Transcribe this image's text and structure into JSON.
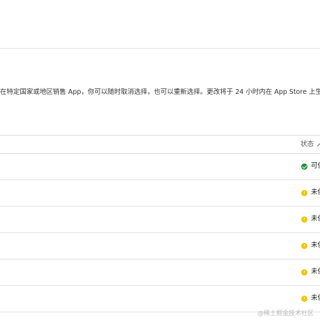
{
  "description": "在特定国家或地区销售 App，你可以随时取消选择，也可以重新选择。更改将于 24 小时内在 App Store 上生",
  "table": {
    "status_header": "状态",
    "rows": [
      {
        "status": "可供",
        "type": "available"
      },
      {
        "status": "未供",
        "type": "pending"
      },
      {
        "status": "未供",
        "type": "pending"
      },
      {
        "status": "未供",
        "type": "pending"
      },
      {
        "status": "未供",
        "type": "pending"
      },
      {
        "status": "未供",
        "type": "pending"
      }
    ]
  },
  "watermark": "@稀土掘金技术社区",
  "colors": {
    "available": "#1f8f3a",
    "pending": "#f2c500"
  }
}
